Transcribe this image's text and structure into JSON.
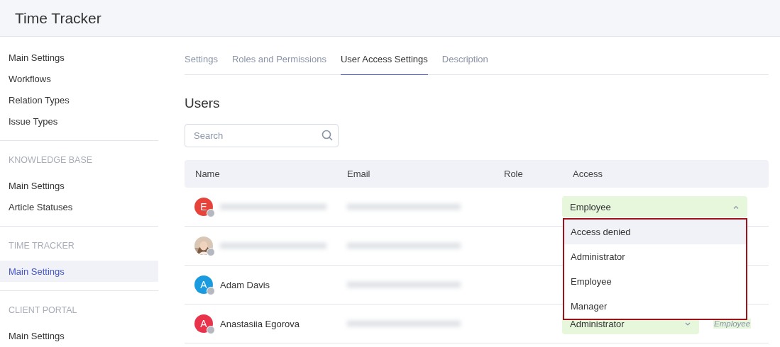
{
  "header": {
    "title": "Time Tracker"
  },
  "sidebar": {
    "groups": [
      {
        "items": [
          {
            "label": "Main Settings",
            "selected": false
          },
          {
            "label": "Workflows",
            "selected": false
          },
          {
            "label": "Relation Types",
            "selected": false
          },
          {
            "label": "Issue Types",
            "selected": false
          }
        ]
      },
      {
        "heading": "KNOWLEDGE BASE",
        "items": [
          {
            "label": "Main Settings",
            "selected": false
          },
          {
            "label": "Article Statuses",
            "selected": false
          }
        ]
      },
      {
        "heading": "TIME TRACKER",
        "items": [
          {
            "label": "Main Settings",
            "selected": true
          }
        ]
      },
      {
        "heading": "CLIENT PORTAL",
        "items": [
          {
            "label": "Main Settings",
            "selected": false
          }
        ]
      }
    ]
  },
  "tabs": [
    {
      "label": "Settings",
      "selected": false
    },
    {
      "label": "Roles and Permissions",
      "selected": false
    },
    {
      "label": "User Access Settings",
      "selected": true
    },
    {
      "label": "Description",
      "selected": false
    }
  ],
  "section_title": "Users",
  "search": {
    "placeholder": "Search"
  },
  "table": {
    "columns": [
      "Name",
      "Email",
      "Role",
      "Access"
    ],
    "rows": [
      {
        "avatar": {
          "kind": "letter",
          "letter": "E",
          "color": "#e8433a"
        },
        "online": false,
        "access": {
          "value": "Employee",
          "open": true
        }
      },
      {
        "online": false
      },
      {
        "avatar": {
          "kind": "letter",
          "letter": "A",
          "color": "#1a9be0"
        },
        "online": false,
        "name": "Adam Davis"
      },
      {
        "avatar": {
          "kind": "letter",
          "letter": "A",
          "color": "#e8334a"
        },
        "online": false,
        "name": "Anastasiia Egorova",
        "access": {
          "value": "Administrator",
          "open": false
        },
        "tag": "Employee"
      }
    ]
  },
  "dropdown": {
    "options": [
      {
        "label": "Access denied",
        "selected": true
      },
      {
        "label": "Administrator",
        "selected": false
      },
      {
        "label": "Employee",
        "selected": false
      },
      {
        "label": "Manager",
        "selected": false
      }
    ]
  }
}
